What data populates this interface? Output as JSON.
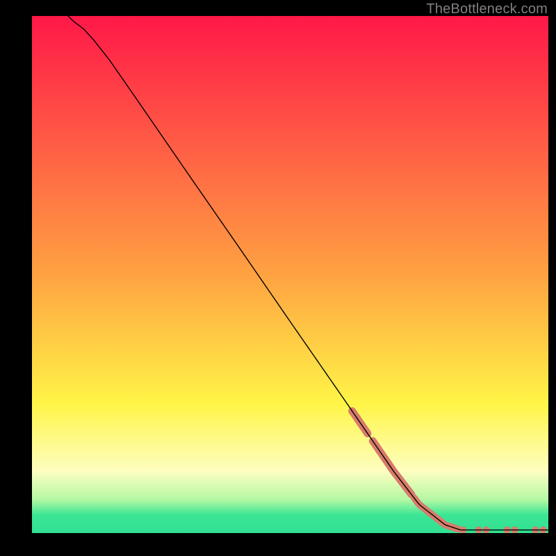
{
  "watermark": "TheBottleneck.com",
  "chart_data": {
    "type": "line",
    "title": "",
    "xlabel": "",
    "ylabel": "",
    "xlim": [
      0,
      100
    ],
    "ylim": [
      0,
      100
    ],
    "background_gradient": {
      "stops": [
        {
          "pos": 0.0,
          "color": "#ff1848"
        },
        {
          "pos": 0.5,
          "color": "#ffa242"
        },
        {
          "pos": 0.75,
          "color": "#fff547"
        },
        {
          "pos": 0.88,
          "color": "#fdfec0"
        },
        {
          "pos": 0.935,
          "color": "#b5f8a4"
        },
        {
          "pos": 0.965,
          "color": "#3be595"
        },
        {
          "pos": 1.0,
          "color": "#31e093"
        }
      ]
    },
    "series": [
      {
        "name": "curve",
        "stroke": "#000000",
        "stroke_width": 1.4,
        "points": [
          {
            "x": 7.0,
            "y": 100.0
          },
          {
            "x": 8.0,
            "y": 99.0
          },
          {
            "x": 10.0,
            "y": 97.5
          },
          {
            "x": 12.0,
            "y": 95.3
          },
          {
            "x": 15.0,
            "y": 91.5
          },
          {
            "x": 20.0,
            "y": 84.3
          },
          {
            "x": 30.0,
            "y": 69.8
          },
          {
            "x": 40.0,
            "y": 55.4
          },
          {
            "x": 50.0,
            "y": 40.9
          },
          {
            "x": 60.0,
            "y": 26.5
          },
          {
            "x": 70.0,
            "y": 12.0
          },
          {
            "x": 75.0,
            "y": 5.5
          },
          {
            "x": 80.0,
            "y": 1.6
          },
          {
            "x": 83.0,
            "y": 0.6
          },
          {
            "x": 88.0,
            "y": 0.6
          },
          {
            "x": 95.0,
            "y": 0.6
          },
          {
            "x": 100.0,
            "y": 0.6
          }
        ]
      }
    ],
    "markers": {
      "color": "#d87b6b",
      "segments": [
        {
          "x1": 62.0,
          "x2": 65.0,
          "width": 11
        },
        {
          "x1": 66.0,
          "x2": 73.5,
          "width": 11
        },
        {
          "x1": 74.0,
          "x2": 77.5,
          "width": 10
        },
        {
          "x1": 77.8,
          "x2": 80.0,
          "width": 10
        },
        {
          "x1": 80.3,
          "x2": 82.5,
          "width": 10
        }
      ],
      "dots": [
        {
          "x": 83.5,
          "r": 5
        },
        {
          "x": 86.5,
          "r": 5
        },
        {
          "x": 88.0,
          "r": 5
        },
        {
          "x": 92.0,
          "r": 5
        },
        {
          "x": 93.5,
          "r": 5
        },
        {
          "x": 97.5,
          "r": 5
        },
        {
          "x": 99.0,
          "r": 5
        }
      ]
    }
  }
}
